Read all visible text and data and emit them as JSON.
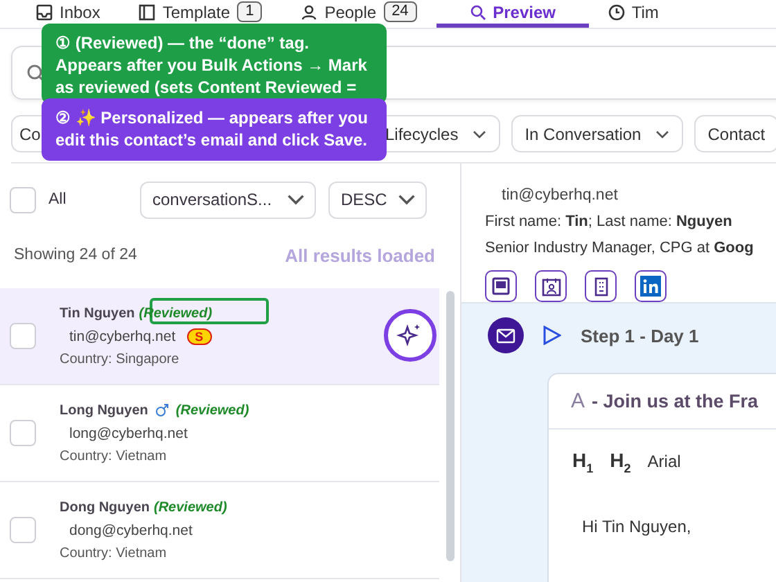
{
  "tabs": [
    {
      "kind": "inbox",
      "label": "Inbox",
      "selected": false
    },
    {
      "kind": "template",
      "label": "Template",
      "badge": "1",
      "selected": false
    },
    {
      "kind": "people",
      "label": "People",
      "badge": "24",
      "selected": false
    },
    {
      "kind": "preview",
      "label": "Preview",
      "selected": true
    },
    {
      "kind": "timeline",
      "label": "Tim",
      "selected": false
    }
  ],
  "callouts": [
    {
      "color": "#1e9e46",
      "text": "① (Reviewed) — the “done” tag. Appears after you Bulk Actions → Mark as reviewed (sets Content Reviewed ="
    },
    {
      "color": "#7b3fe4",
      "text": "② ✨ Personalized — appears after you edit this contact’s email and click Save."
    }
  ],
  "filters": [
    {
      "label": "Co"
    },
    {
      "label": "Lifecycles",
      "chevron": true
    },
    {
      "label": "In Conversation",
      "chevron": true
    },
    {
      "label": "Contact",
      "chevron": false
    }
  ],
  "list_controls": {
    "select_all": {
      "label": "All",
      "checked": false
    },
    "sort_field": "conversationS...",
    "sort_order": "DESC"
  },
  "summary": {
    "count": "Showing 24 of 24",
    "status": "All results loaded"
  },
  "contacts": [
    {
      "name": "Tin Nguyen",
      "male": false,
      "tag": "(Reviewed)",
      "outlined": true,
      "email": "tin@cyberhq.net",
      "badge": "S",
      "country": "Country: Singapore",
      "selected": true,
      "checked": false,
      "personalized": true
    },
    {
      "name": "Long Nguyen",
      "male": true,
      "tag": "(Reviewed)",
      "outlined": false,
      "email": "long@cyberhq.net",
      "country": "Country: Vietnam",
      "selected": false,
      "checked": false,
      "personalized": false
    },
    {
      "name": "Dong Nguyen",
      "male": false,
      "tag": "(Reviewed)",
      "outlined": false,
      "email": "dong@cyberhq.net",
      "country": "Country: Vietnam",
      "selected": false,
      "checked": false,
      "personalized": false
    }
  ],
  "preview": {
    "email": "tin@cyberhq.net",
    "name_line": "First name: **Tin**; Last name: **Nguyen**",
    "title_line": "Senior Industry Manager, CPG at **Goog**",
    "links": [
      {
        "kind": "contact"
      },
      {
        "kind": "calendar"
      },
      {
        "kind": "company"
      },
      {
        "kind": "linkedin"
      }
    ],
    "step": {
      "label": "Step 1 - Day 1"
    },
    "email_card": {
      "variant": "A",
      "subject": "- Join us at the Fra",
      "toolbar": [
        "H$_{1}$",
        "H$_{2}$",
        "Arial"
      ],
      "body": "Hi Tin Nguyen,"
    }
  }
}
